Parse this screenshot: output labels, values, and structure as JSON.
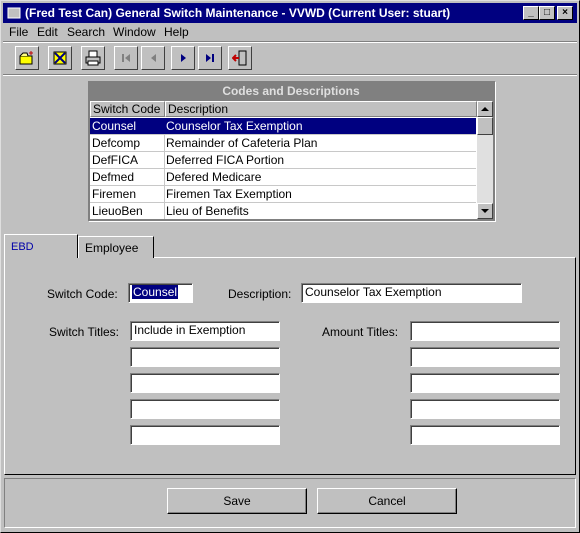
{
  "window": {
    "title": "(Fred Test Can) General Switch Maintenance - VVWD (Current User: stuart)",
    "controls": [
      "_",
      "□",
      "×"
    ]
  },
  "menu": [
    "File",
    "Edit",
    "Search",
    "Window",
    "Help"
  ],
  "toolbar": {
    "buttons": [
      "new-icon",
      "delete-icon",
      "print-icon",
      "first-icon",
      "prev-icon",
      "next-icon",
      "last-icon",
      "exit-icon"
    ]
  },
  "codes_list": {
    "title": "Codes and Descriptions",
    "columns": [
      "Switch Code",
      "Description"
    ],
    "rows": [
      {
        "code": "Counsel",
        "desc": "Counselor Tax Exemption",
        "selected": true
      },
      {
        "code": "Defcomp",
        "desc": "Remainder of Cafeteria Plan",
        "selected": false
      },
      {
        "code": "DefFICA",
        "desc": "Deferred FICA Portion",
        "selected": false
      },
      {
        "code": "Defmed",
        "desc": "Defered Medicare",
        "selected": false
      },
      {
        "code": "Firemen",
        "desc": "Firemen Tax Exemption",
        "selected": false
      },
      {
        "code": "LieuoBen",
        "desc": "Lieu of Benefits",
        "selected": false
      }
    ]
  },
  "tabs": [
    "EBD",
    "Employee"
  ],
  "form": {
    "switch_code_label": "Switch Code:",
    "switch_code_value": "Counsel",
    "description_label": "Description:",
    "description_value": "Counselor Tax Exemption",
    "switch_titles_label": "Switch Titles:",
    "switch_titles": [
      "Include in Exemption",
      "",
      "",
      "",
      ""
    ],
    "amount_titles_label": "Amount Titles:",
    "amount_titles": [
      "",
      "",
      "",
      "",
      ""
    ]
  },
  "buttons": {
    "save": "Save",
    "cancel": "Cancel"
  }
}
